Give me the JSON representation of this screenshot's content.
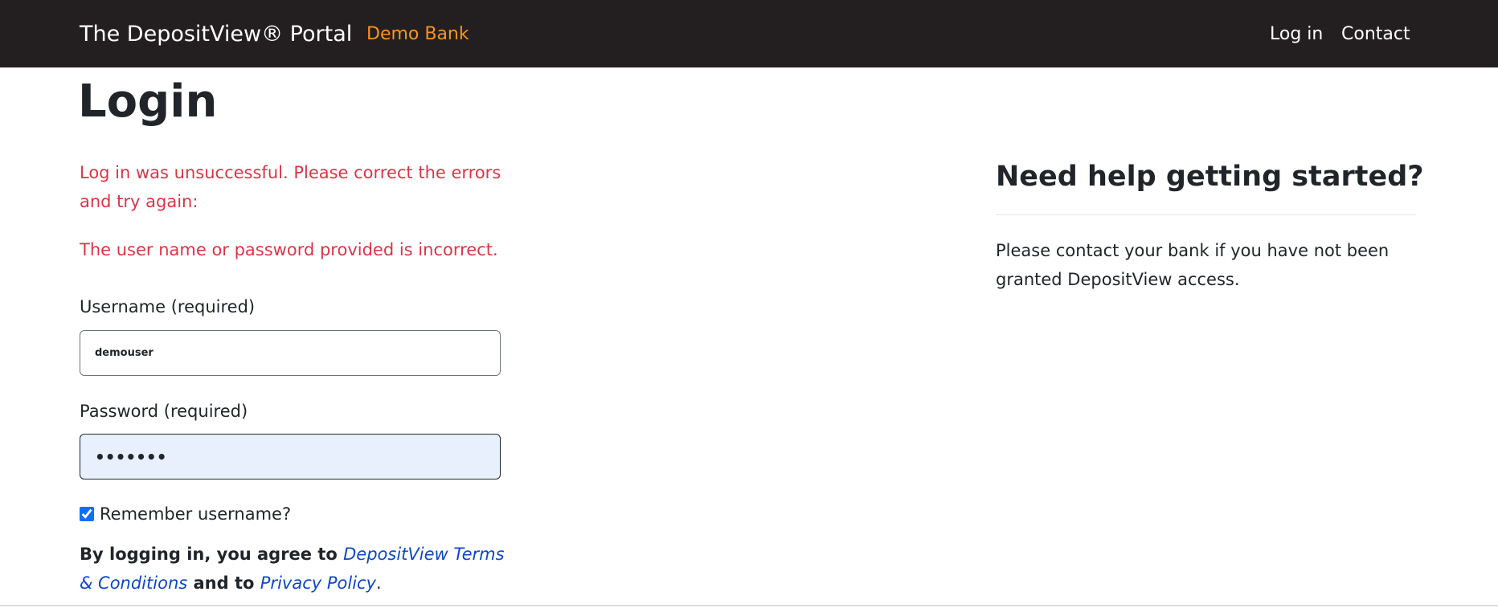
{
  "navbar": {
    "brand": "The DepositView® Portal",
    "bank_name": "Demo Bank",
    "links": [
      {
        "label": "Log in"
      },
      {
        "label": "Contact"
      }
    ],
    "background_color": "#231f20",
    "bank_color": "#f7941d"
  },
  "login": {
    "title": "Login",
    "error_summary": "Log in was unsuccessful. Please correct the errors and try again:",
    "error_detail": "The user name or password provided is incorrect.",
    "error_color": "#dc3545",
    "username": {
      "label": "Username (required)",
      "value": "demouser"
    },
    "password": {
      "label": "Password (required)",
      "value": "•••••••"
    },
    "remember": {
      "label": "Remember username?",
      "checked": true
    },
    "agreement": {
      "prefix": "By logging in, you agree to ",
      "terms_link": "DepositView Terms & Conditions",
      "middle": " and to ",
      "privacy_link": "Privacy Policy",
      "suffix": "."
    }
  },
  "help": {
    "heading": "Need help getting started?",
    "text": "Please contact your bank if you have not been granted DepositView access."
  },
  "icons": {
    "remember_checkbox": "checkbox-checked-icon"
  }
}
